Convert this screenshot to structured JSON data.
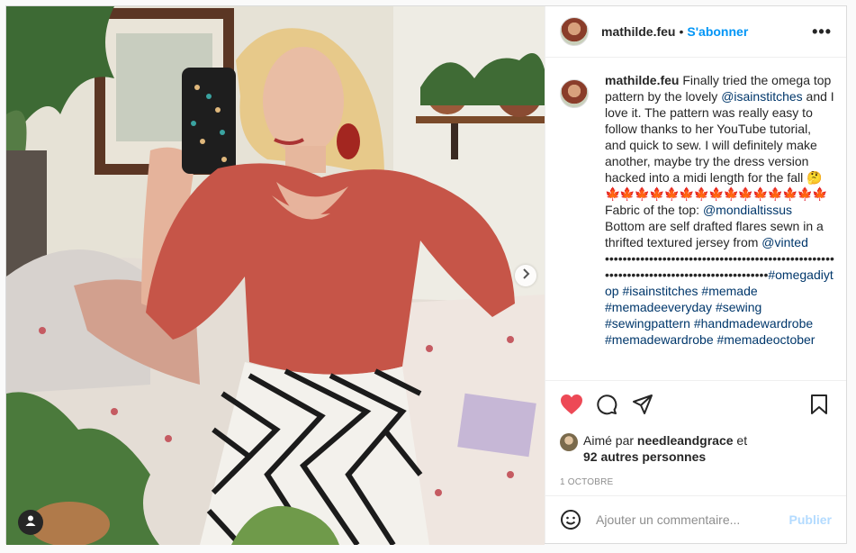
{
  "post": {
    "username": "mathilde.feu",
    "header_separator": "•",
    "follow_label": "S'abonner",
    "more_label": "•••",
    "caption_segments": [
      {
        "text": "Finally tried the omega top pattern by the lovely ",
        "kind": "plain"
      },
      {
        "text": "@isainstitches",
        "kind": "link"
      },
      {
        "text": " and I love it. The pattern was really easy to follow thanks to her YouTube tutorial, and quick to sew. I will definitely make another, maybe try the dress version hacked into a midi length for the fall 🤔",
        "kind": "plain"
      },
      {
        "text": "🍁🍁🍁🍁🍁🍁🍁🍁🍁🍁🍁🍁🍁🍁🍁",
        "kind": "emoji"
      },
      {
        "text": "Fabric of the top: ",
        "kind": "plain"
      },
      {
        "text": "@mondialtissus",
        "kind": "link"
      },
      {
        "text": " Bottom are self drafted flares sewn in a thrifted textured jersey from ",
        "kind": "plain"
      },
      {
        "text": "@vinted",
        "kind": "link"
      },
      {
        "text": " •••••••••••••••••••••••••••••••••••••••••••••••••••••••••••••••••••••••••••••••••••••••••",
        "kind": "plain"
      },
      {
        "text": "#omegadiytop",
        "kind": "link"
      },
      {
        "text": " ",
        "kind": "plain"
      },
      {
        "text": "#isainstitches",
        "kind": "link"
      },
      {
        "text": " ",
        "kind": "plain"
      },
      {
        "text": "#memade",
        "kind": "link"
      },
      {
        "text": " ",
        "kind": "plain"
      },
      {
        "text": "#memadeeveryday",
        "kind": "link"
      },
      {
        "text": " ",
        "kind": "plain"
      },
      {
        "text": "#sewing",
        "kind": "link"
      },
      {
        "text": " ",
        "kind": "plain"
      },
      {
        "text": "#sewingpattern",
        "kind": "link"
      },
      {
        "text": " ",
        "kind": "plain"
      },
      {
        "text": "#handmadewardrobe",
        "kind": "link"
      },
      {
        "text": " ",
        "kind": "plain"
      },
      {
        "text": "#memadewardrobe",
        "kind": "link"
      },
      {
        "text": " ",
        "kind": "plain"
      },
      {
        "text": "#memadeoctober",
        "kind": "link"
      }
    ],
    "likes": {
      "prefix": "Aimé par ",
      "user": "needleandgrace",
      "middle": " et",
      "others": "92 autres personnes"
    },
    "date": "1 OCTOBRE",
    "comment_box": {
      "placeholder": "Ajouter un commentaire...",
      "value": "",
      "publish_label": "Publier"
    }
  },
  "icons": {
    "next": "chevron-right-icon",
    "user_tag": "user-tag-icon",
    "like": "heart-filled-icon",
    "comment": "comment-bubble-icon",
    "share": "paper-plane-icon",
    "save": "bookmark-icon",
    "emoji": "smiley-icon"
  },
  "colors": {
    "like": "#ed4956",
    "follow": "#0095f6",
    "link": "#00376b",
    "publish_disabled": "#b3dbff",
    "muted": "#8e8e8e"
  }
}
